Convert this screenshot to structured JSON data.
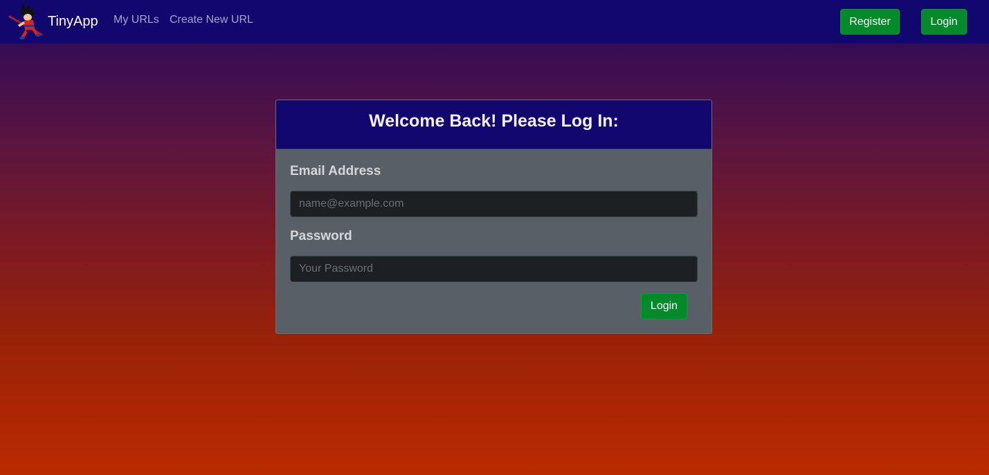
{
  "navbar": {
    "brand": "TinyApp",
    "links": [
      {
        "label": "My URLs"
      },
      {
        "label": "Create New URL"
      }
    ],
    "register_label": "Register",
    "login_label": "Login"
  },
  "login_card": {
    "title": "Welcome Back! Please Log In:",
    "email_label": "Email Address",
    "email_placeholder": "name@example.com",
    "email_value": "",
    "password_label": "Password",
    "password_placeholder": "Your Password",
    "password_value": "",
    "submit_label": "Login"
  },
  "colors": {
    "navbar_bg": "#11076f",
    "button_green": "#058a2b",
    "card_bg": "#595f66",
    "input_bg": "#1d2022"
  }
}
